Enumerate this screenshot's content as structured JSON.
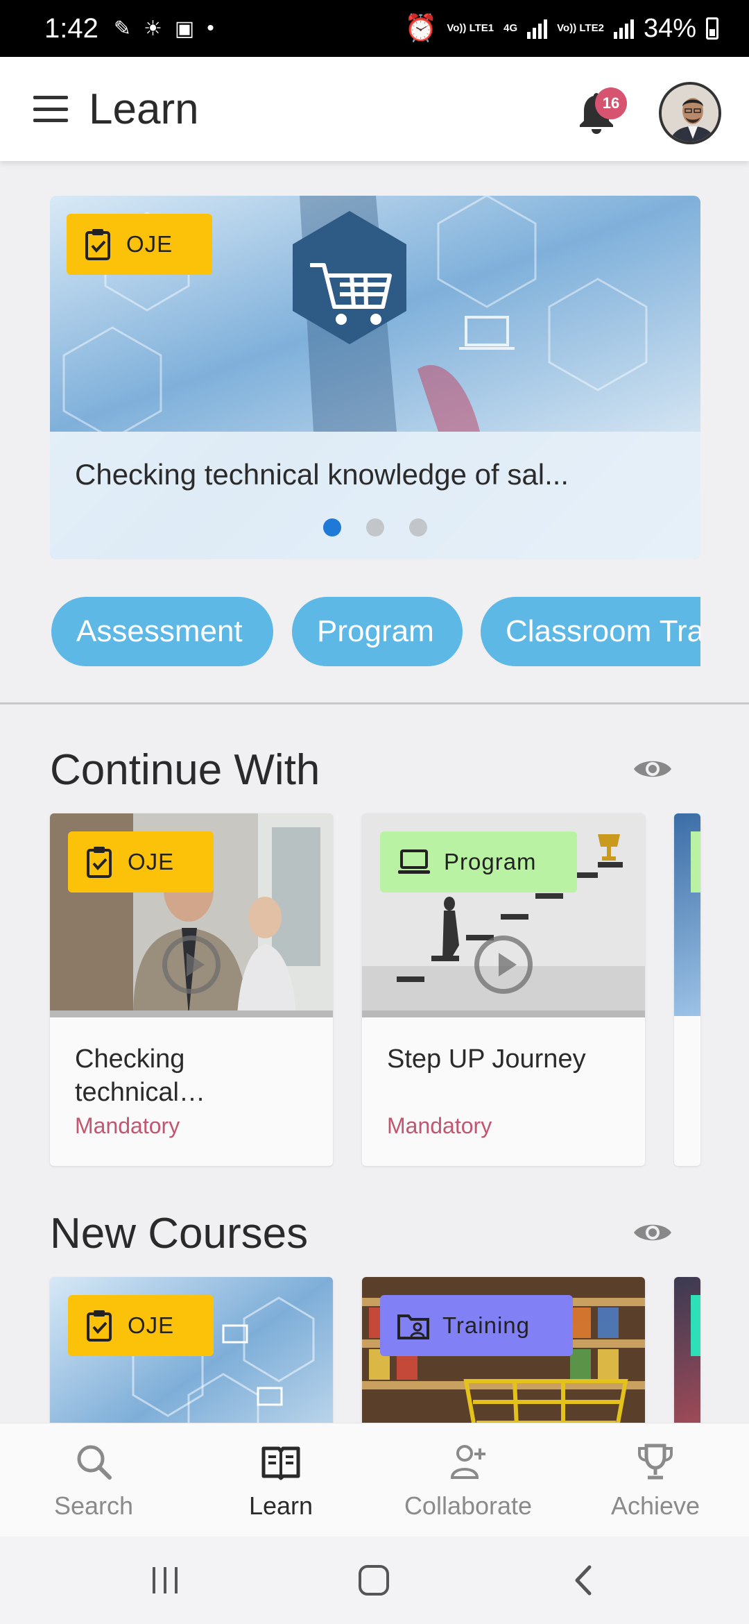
{
  "status_bar": {
    "time": "1:42",
    "sim1_label": "Vo)) LTE1",
    "network_label": "4G",
    "sim2_label": "Vo)) LTE2",
    "battery": "34%"
  },
  "app_bar": {
    "title": "Learn",
    "notification_count": "16"
  },
  "hero": {
    "tag": "OJE",
    "title": "Checking technical knowledge of sal...",
    "slide_count": 3,
    "active_slide": 1
  },
  "filters": [
    "Assessment",
    "Program",
    "Classroom Tra"
  ],
  "continue_with": {
    "title": "Continue With",
    "cards": [
      {
        "tag": "OJE",
        "title": "Checking technical…",
        "meta": "Mandatory"
      },
      {
        "tag": "Program",
        "title": "Step UP Journey",
        "meta": "Mandatory"
      }
    ]
  },
  "new_courses": {
    "title": "New Courses",
    "cards": [
      {
        "tag": "OJE"
      },
      {
        "tag": "Training"
      }
    ]
  },
  "bottom_nav": [
    {
      "label": "Search",
      "icon": "search-icon"
    },
    {
      "label": "Learn",
      "icon": "book-icon",
      "active": true
    },
    {
      "label": "Collaborate",
      "icon": "add-person-icon"
    },
    {
      "label": "Achieve",
      "icon": "trophy-icon"
    }
  ],
  "colors": {
    "oje_tag": "#fcc20a",
    "program_tag": "#b8f2a2",
    "training_tag": "#8180f5",
    "pill": "#5db8e6",
    "mandatory": "#c0566f",
    "badge": "#d6546f",
    "active_dot": "#1e7ad6"
  }
}
